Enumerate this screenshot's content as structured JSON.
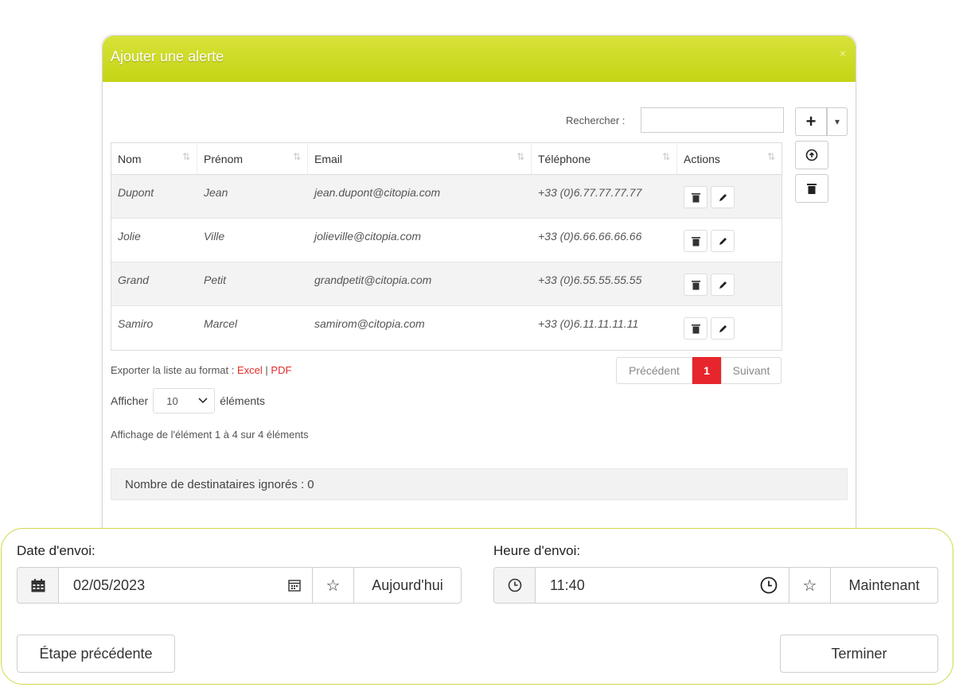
{
  "modal": {
    "title": "Ajouter une alerte",
    "close": "×",
    "search_label": "Rechercher :",
    "search_value": ""
  },
  "tools": {
    "add": "+",
    "dropdown": "▾"
  },
  "table": {
    "headers": [
      "Nom",
      "Prénom",
      "Email",
      "Téléphone",
      "Actions"
    ],
    "rows": [
      {
        "nom": "Dupont",
        "prenom": "Jean",
        "email": "jean.dupont@citopia.com",
        "telephone": "+33 (0)6.77.77.77.77"
      },
      {
        "nom": "Jolie",
        "prenom": "Ville",
        "email": "jolieville@citopia.com",
        "telephone": "+33 (0)6.66.66.66.66"
      },
      {
        "nom": "Grand",
        "prenom": "Petit",
        "email": "grandpetit@citopia.com",
        "telephone": "+33 (0)6.55.55.55.55"
      },
      {
        "nom": "Samiro",
        "prenom": "Marcel",
        "email": "samirom@citopia.com",
        "telephone": "+33 (0)6.11.11.11.11"
      }
    ]
  },
  "export": {
    "prefix": "Exporter la liste au format :",
    "excel": "Excel",
    "sep": "|",
    "pdf": "PDF"
  },
  "pager": {
    "prev": "Précédent",
    "current": "1",
    "next": "Suivant"
  },
  "show": {
    "prefix": "Afficher",
    "value": "10",
    "suffix": "éléments"
  },
  "info": "Affichage de l'élément 1 à 4 sur 4 éléments",
  "ignored": "Nombre de destinataires ignorés : 0",
  "send": {
    "date_label": "Date d'envoi:",
    "date_value": "02/05/2023",
    "today": "Aujourd'hui",
    "time_label": "Heure d'envoi:",
    "time_value": "11:40",
    "now": "Maintenant",
    "star": "☆"
  },
  "buttons": {
    "previous_step": "Étape précédente",
    "finish": "Terminer"
  },
  "colors": {
    "header": "#c9d71d",
    "accent_red": "#e6262c",
    "panel_border": "#d2d84c"
  }
}
